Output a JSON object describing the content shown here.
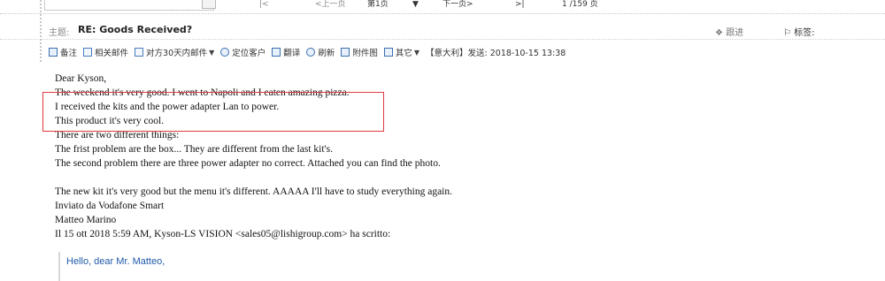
{
  "pager": {
    "first": "|<",
    "prev": "<上一页",
    "page": "第1页",
    "dropdown": "▼",
    "next": "下一页>",
    "last": ">|",
    "count": "1 /159 页"
  },
  "subject": {
    "label": "主题:",
    "text": "RE: Goods Received?",
    "follow": "跟进",
    "tag_label": "标签:"
  },
  "toolbar": {
    "items": [
      "备注",
      "相关邮件",
      "对方30天内邮件",
      "定位客户",
      "翻译",
      "刷新",
      "附件图",
      "其它"
    ],
    "sent_info": "【意大利】发送: 2018-10-15 13:38"
  },
  "email": {
    "lines": [
      "Dear Kyson,",
      "The weekend it's very good. I went to Napoli and I eaten amazing pizza.",
      "I received the kits and the power adapter Lan to power.",
      "This product it's very cool.",
      "There are two different things:",
      "The frist problem are the box... They are different from the last kit's.",
      "The second problem there are three power adapter no correct. Attached you can find the photo.",
      "",
      "The new kit it's very good but the menu it's different. AAAAA  I'll have to study everything again.",
      "Inviato da Vodafone Smart",
      "Matteo Marino",
      "Il 15 ott 2018 5:59 AM, Kyson-LS VISION <sales05@lishigroup.com> ha scritto:"
    ],
    "quote": "Hello, dear Mr. Matteo,"
  },
  "colors": {
    "highlight": "#e0393e",
    "quote_text": "#1f5aa8"
  }
}
